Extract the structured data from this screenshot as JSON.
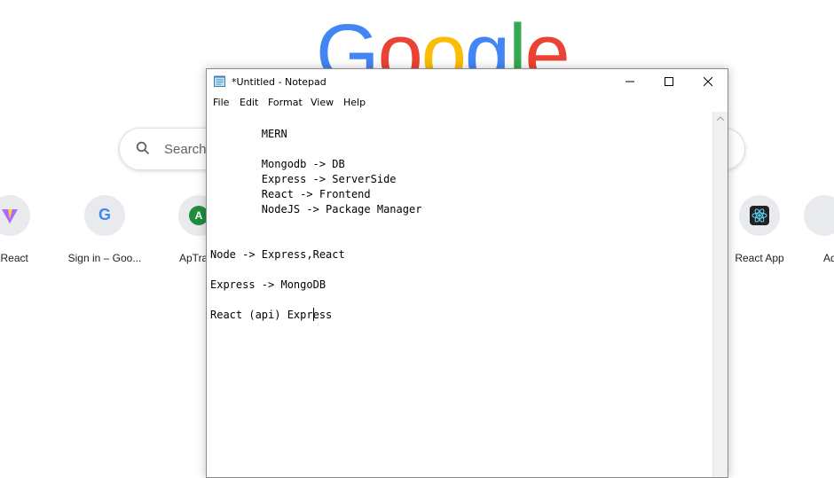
{
  "browser": {
    "logo_letters": [
      {
        "ch": "G",
        "color": "#4285F4"
      },
      {
        "ch": "o",
        "color": "#EA4335"
      },
      {
        "ch": "o",
        "color": "#FBBC05"
      },
      {
        "ch": "g",
        "color": "#4285F4"
      },
      {
        "ch": "l",
        "color": "#34A853"
      },
      {
        "ch": "e",
        "color": "#EA4335"
      }
    ],
    "search_placeholder": "Search",
    "shortcuts": [
      {
        "label": "+ React",
        "icon": "vite-icon"
      },
      {
        "label": "Sign in – Goo...",
        "icon": "google-g-icon",
        "glyph": "G"
      },
      {
        "label": "ApTra",
        "icon": "letter-avatar-icon",
        "glyph": "A",
        "color": "#1e8e3e"
      },
      {
        "label": "React App",
        "icon": "react-icon"
      },
      {
        "label": "Ad",
        "icon": "add-shortcut-icon"
      }
    ]
  },
  "notepad": {
    "title": "*Untitled - Notepad",
    "menu": [
      "File",
      "Edit",
      "Format",
      "View",
      "Help"
    ],
    "window_controls": {
      "minimize": "─",
      "maximize": "☐",
      "close": "✕"
    },
    "lines": [
      "        MERN",
      "",
      "        Mongodb -> DB",
      "        Express -> ServerSide",
      "        React -> Frontend",
      "        NodeJS -> Package Manager",
      "Node -> Express,React",
      "Express -> MongoDB",
      "React (api) Express"
    ]
  }
}
